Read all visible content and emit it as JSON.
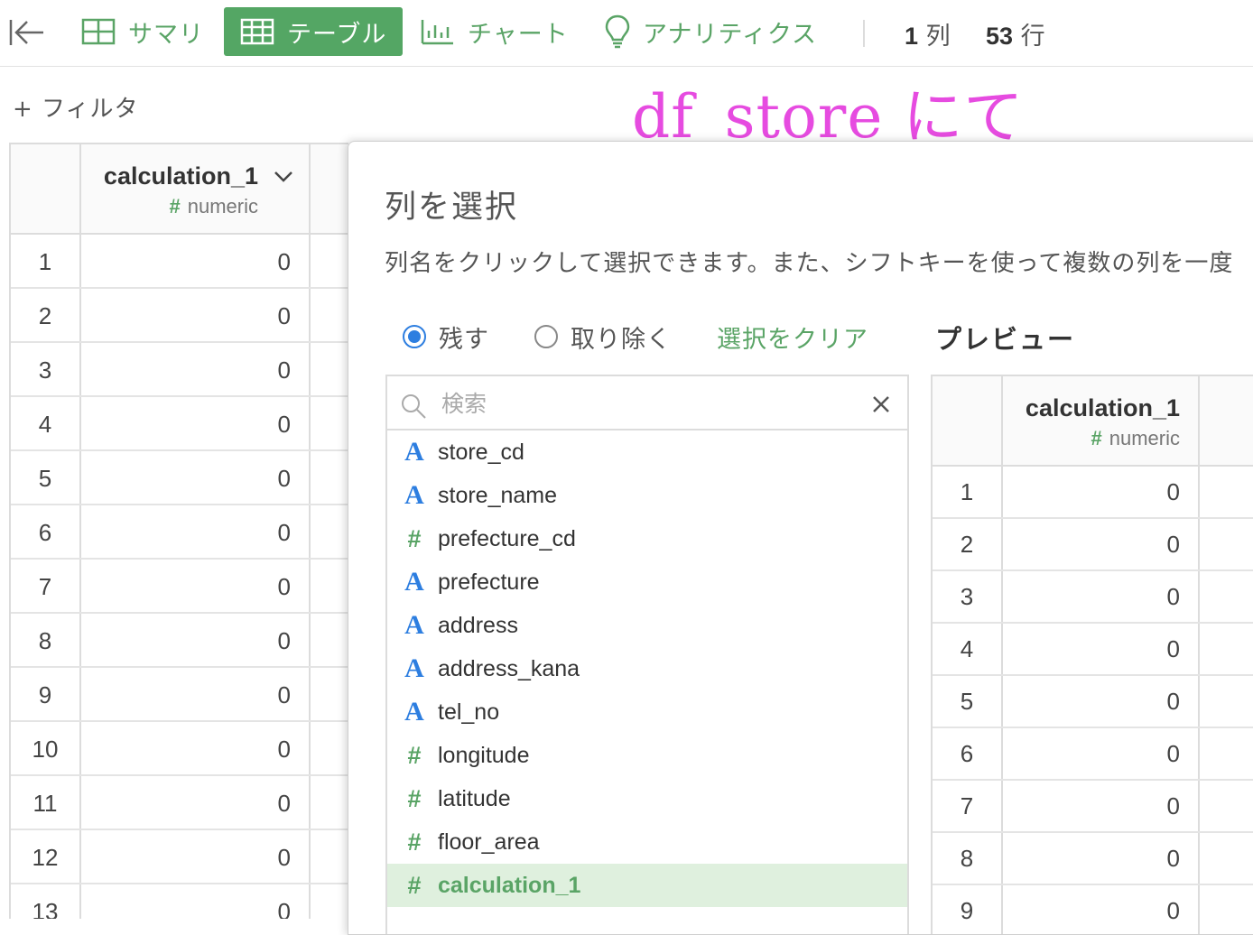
{
  "toolbar": {
    "summary_label": "サマリ",
    "table_label": "テーブル",
    "chart_label": "チャート",
    "analytics_label": "アナリティクス",
    "col_count": "1",
    "col_unit": "列",
    "row_count": "53",
    "row_unit": "行"
  },
  "filter": {
    "label": "+ フィルタ"
  },
  "annotation": "df_store にて",
  "left_table": {
    "column": {
      "name": "calculation_1",
      "type": "numeric",
      "type_icon": "#"
    },
    "rows": [
      {
        "idx": "1",
        "val": "0"
      },
      {
        "idx": "2",
        "val": "0"
      },
      {
        "idx": "3",
        "val": "0"
      },
      {
        "idx": "4",
        "val": "0"
      },
      {
        "idx": "5",
        "val": "0"
      },
      {
        "idx": "6",
        "val": "0"
      },
      {
        "idx": "7",
        "val": "0"
      },
      {
        "idx": "8",
        "val": "0"
      },
      {
        "idx": "9",
        "val": "0"
      },
      {
        "idx": "10",
        "val": "0"
      },
      {
        "idx": "11",
        "val": "0"
      },
      {
        "idx": "12",
        "val": "0"
      },
      {
        "idx": "13",
        "val": "0"
      }
    ]
  },
  "dialog": {
    "title": "列を選択",
    "description": "列名をクリックして選択できます。また、シフトキーを使って複数の列を一度",
    "radio_keep": "残す",
    "radio_remove": "取り除く",
    "clear_selection": "選択をクリア",
    "preview_title": "プレビュー",
    "search_placeholder": "検索",
    "columns": [
      {
        "name": "store_cd",
        "kind": "str",
        "icon": "A"
      },
      {
        "name": "store_name",
        "kind": "str",
        "icon": "A"
      },
      {
        "name": "prefecture_cd",
        "kind": "num",
        "icon": "#"
      },
      {
        "name": "prefecture",
        "kind": "str",
        "icon": "A"
      },
      {
        "name": "address",
        "kind": "str",
        "icon": "A"
      },
      {
        "name": "address_kana",
        "kind": "str",
        "icon": "A"
      },
      {
        "name": "tel_no",
        "kind": "str",
        "icon": "A"
      },
      {
        "name": "longitude",
        "kind": "num",
        "icon": "#"
      },
      {
        "name": "latitude",
        "kind": "num",
        "icon": "#"
      },
      {
        "name": "floor_area",
        "kind": "num",
        "icon": "#"
      },
      {
        "name": "calculation_1",
        "kind": "num",
        "icon": "#",
        "selected": true
      }
    ],
    "preview": {
      "column": {
        "name": "calculation_1",
        "type": "numeric",
        "type_icon": "#"
      },
      "rows": [
        {
          "idx": "1",
          "val": "0"
        },
        {
          "idx": "2",
          "val": "0"
        },
        {
          "idx": "3",
          "val": "0"
        },
        {
          "idx": "4",
          "val": "0"
        },
        {
          "idx": "5",
          "val": "0"
        },
        {
          "idx": "6",
          "val": "0"
        },
        {
          "idx": "7",
          "val": "0"
        },
        {
          "idx": "8",
          "val": "0"
        },
        {
          "idx": "9",
          "val": "0"
        }
      ]
    }
  }
}
